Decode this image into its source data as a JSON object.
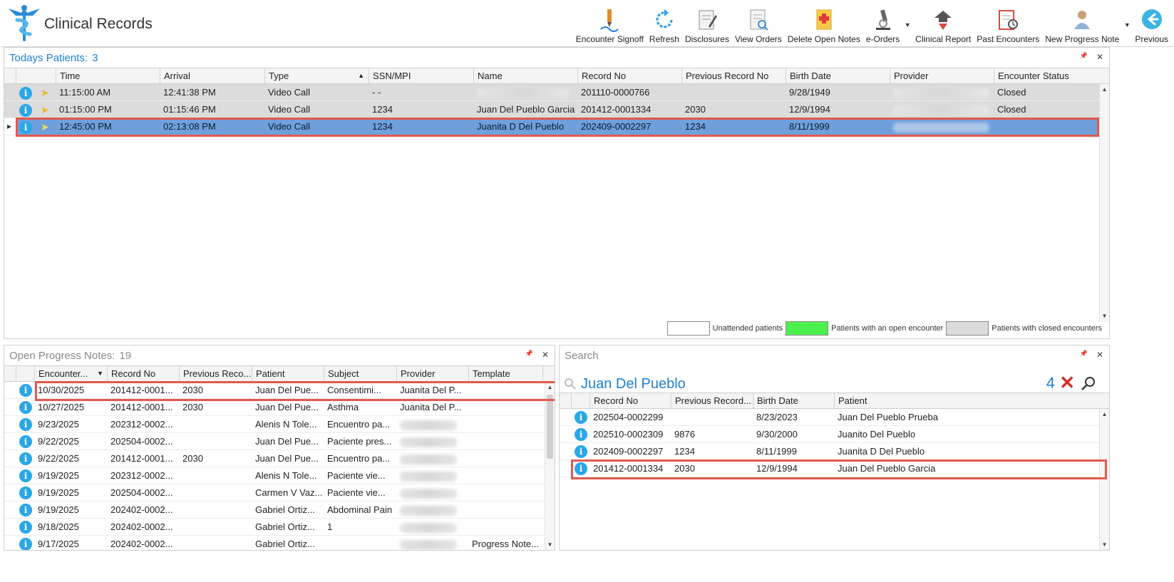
{
  "app": {
    "title": "Clinical Records"
  },
  "toolbar": {
    "buttons": [
      {
        "label": "Encounter Signoff",
        "icon": "pen-signoff-icon"
      },
      {
        "label": "Refresh",
        "icon": "refresh-icon"
      },
      {
        "label": "Disclosures",
        "icon": "disclosures-icon"
      },
      {
        "label": "View Orders",
        "icon": "view-orders-icon"
      },
      {
        "label": "Delete Open Notes",
        "icon": "delete-notes-icon"
      },
      {
        "label": "e-Orders",
        "icon": "microscope-icon"
      },
      {
        "label": "Clinical Report",
        "icon": "clinical-report-icon"
      },
      {
        "label": "Past Encounters",
        "icon": "past-encounters-icon"
      },
      {
        "label": "New Progress Note",
        "icon": "new-progress-note-icon"
      },
      {
        "label": "Previous",
        "icon": "back-arrow-icon"
      }
    ]
  },
  "todays": {
    "title": "Todays Patients:",
    "count": "3",
    "columns": [
      "Time",
      "Arrival",
      "Type",
      "SSN/MPI",
      "Name",
      "Record No",
      "Previous Record No",
      "Birth Date",
      "Provider",
      "Encounter Status"
    ],
    "rows": [
      {
        "time": "11:15:00 AM",
        "arrival": "12:41:38 PM",
        "type": "Video Call",
        "ssn": "- -",
        "name": "",
        "record": "201110-0000766",
        "prev": "",
        "birth": "9/28/1949",
        "status": "Closed",
        "state": "closed"
      },
      {
        "time": "01:15:00 PM",
        "arrival": "01:15:46 PM",
        "type": "Video Call",
        "ssn": "1234",
        "name": "Juan Del Pueblo Garcia",
        "record": "201412-0001334",
        "prev": "2030",
        "birth": "12/9/1994",
        "status": "Closed",
        "state": "closed"
      },
      {
        "time": "12:45:00 PM",
        "arrival": "02:13:08 PM",
        "type": "Video Call",
        "ssn": "1234",
        "name": "Juanita D Del Pueblo",
        "record": "202409-0002297",
        "prev": "1234",
        "birth": "8/11/1999",
        "status": "",
        "state": "selected"
      }
    ],
    "legend": {
      "unattended": "Unattended patients",
      "open": "Patients with an open encounter",
      "closed": "Patients with closed encounters",
      "colors": {
        "unattended": "#ffffff",
        "open": "#4cf04c",
        "closed": "#dcdcdc"
      }
    }
  },
  "notes": {
    "title": "Open Progress Notes:",
    "count": "19",
    "columns": [
      "Encounter...",
      "Record No",
      "Previous Reco...",
      "Patient",
      "Subject",
      "Provider",
      "Template"
    ],
    "rows": [
      {
        "date": "10/30/2025",
        "record": "201412-0001...",
        "prev": "2030",
        "patient": "Juan Del Pue...",
        "subject": "Consentimi...",
        "provider": "Juanita Del P...",
        "template": ""
      },
      {
        "date": "10/27/2025",
        "record": "201412-0001...",
        "prev": "2030",
        "patient": "Juan Del Pue...",
        "subject": "Asthma",
        "provider": "Juanita Del P...",
        "template": ""
      },
      {
        "date": "9/23/2025",
        "record": "202312-0002...",
        "prev": "",
        "patient": "Alenis N Tole...",
        "subject": "Encuentro pa...",
        "provider": "",
        "template": ""
      },
      {
        "date": "9/22/2025",
        "record": "202504-0002...",
        "prev": "",
        "patient": "Juan Del Pue...",
        "subject": "Paciente pres...",
        "provider": "",
        "template": ""
      },
      {
        "date": "9/22/2025",
        "record": "201412-0001...",
        "prev": "2030",
        "patient": "Juan Del Pue...",
        "subject": "Encuentro pa...",
        "provider": "",
        "template": ""
      },
      {
        "date": "9/19/2025",
        "record": "202312-0002...",
        "prev": "",
        "patient": "Alenis N Tole...",
        "subject": "Paciente vie...",
        "provider": "",
        "template": ""
      },
      {
        "date": "9/19/2025",
        "record": "202504-0002...",
        "prev": "",
        "patient": "Carmen V Vaz...",
        "subject": "Paciente vie...",
        "provider": "",
        "template": ""
      },
      {
        "date": "9/19/2025",
        "record": "202402-0002...",
        "prev": "",
        "patient": "Gabriel Ortiz...",
        "subject": "Abdominal Pain",
        "provider": "",
        "template": ""
      },
      {
        "date": "9/18/2025",
        "record": "202402-0002...",
        "prev": "",
        "patient": "Gabriel Ortiz...",
        "subject": "1",
        "provider": "",
        "template": ""
      },
      {
        "date": "9/17/2025",
        "record": "202402-0002...",
        "prev": "",
        "patient": "Gabriel Ortiz...",
        "subject": "",
        "provider": "",
        "template": "Progress Note..."
      }
    ]
  },
  "search": {
    "title": "Search",
    "query": "Juan Del Pueblo",
    "result_count": "4",
    "columns": [
      "Record No",
      "Previous Record...",
      "Birth Date",
      "Patient"
    ],
    "rows": [
      {
        "record": "202504-0002299",
        "prev": "",
        "birth": "8/23/2023",
        "patient": "Juan Del Pueblo Prueba"
      },
      {
        "record": "202510-0002309",
        "prev": "9876",
        "birth": "9/30/2000",
        "patient": "Juanito Del Pueblo"
      },
      {
        "record": "202409-0002297",
        "prev": "1234",
        "birth": "8/11/1999",
        "patient": "Juanita D Del Pueblo"
      },
      {
        "record": "201412-0001334",
        "prev": "2030",
        "birth": "12/9/1994",
        "patient": "Juan Del Pueblo Garcia"
      }
    ]
  },
  "panel_controls": {
    "pin": "📌",
    "close": "✕"
  },
  "colors": {
    "accent": "#1f7fd1",
    "selected_row": "#6fa0dc",
    "highlight": "#e05a4f",
    "info_icon": "#29a7e8"
  }
}
